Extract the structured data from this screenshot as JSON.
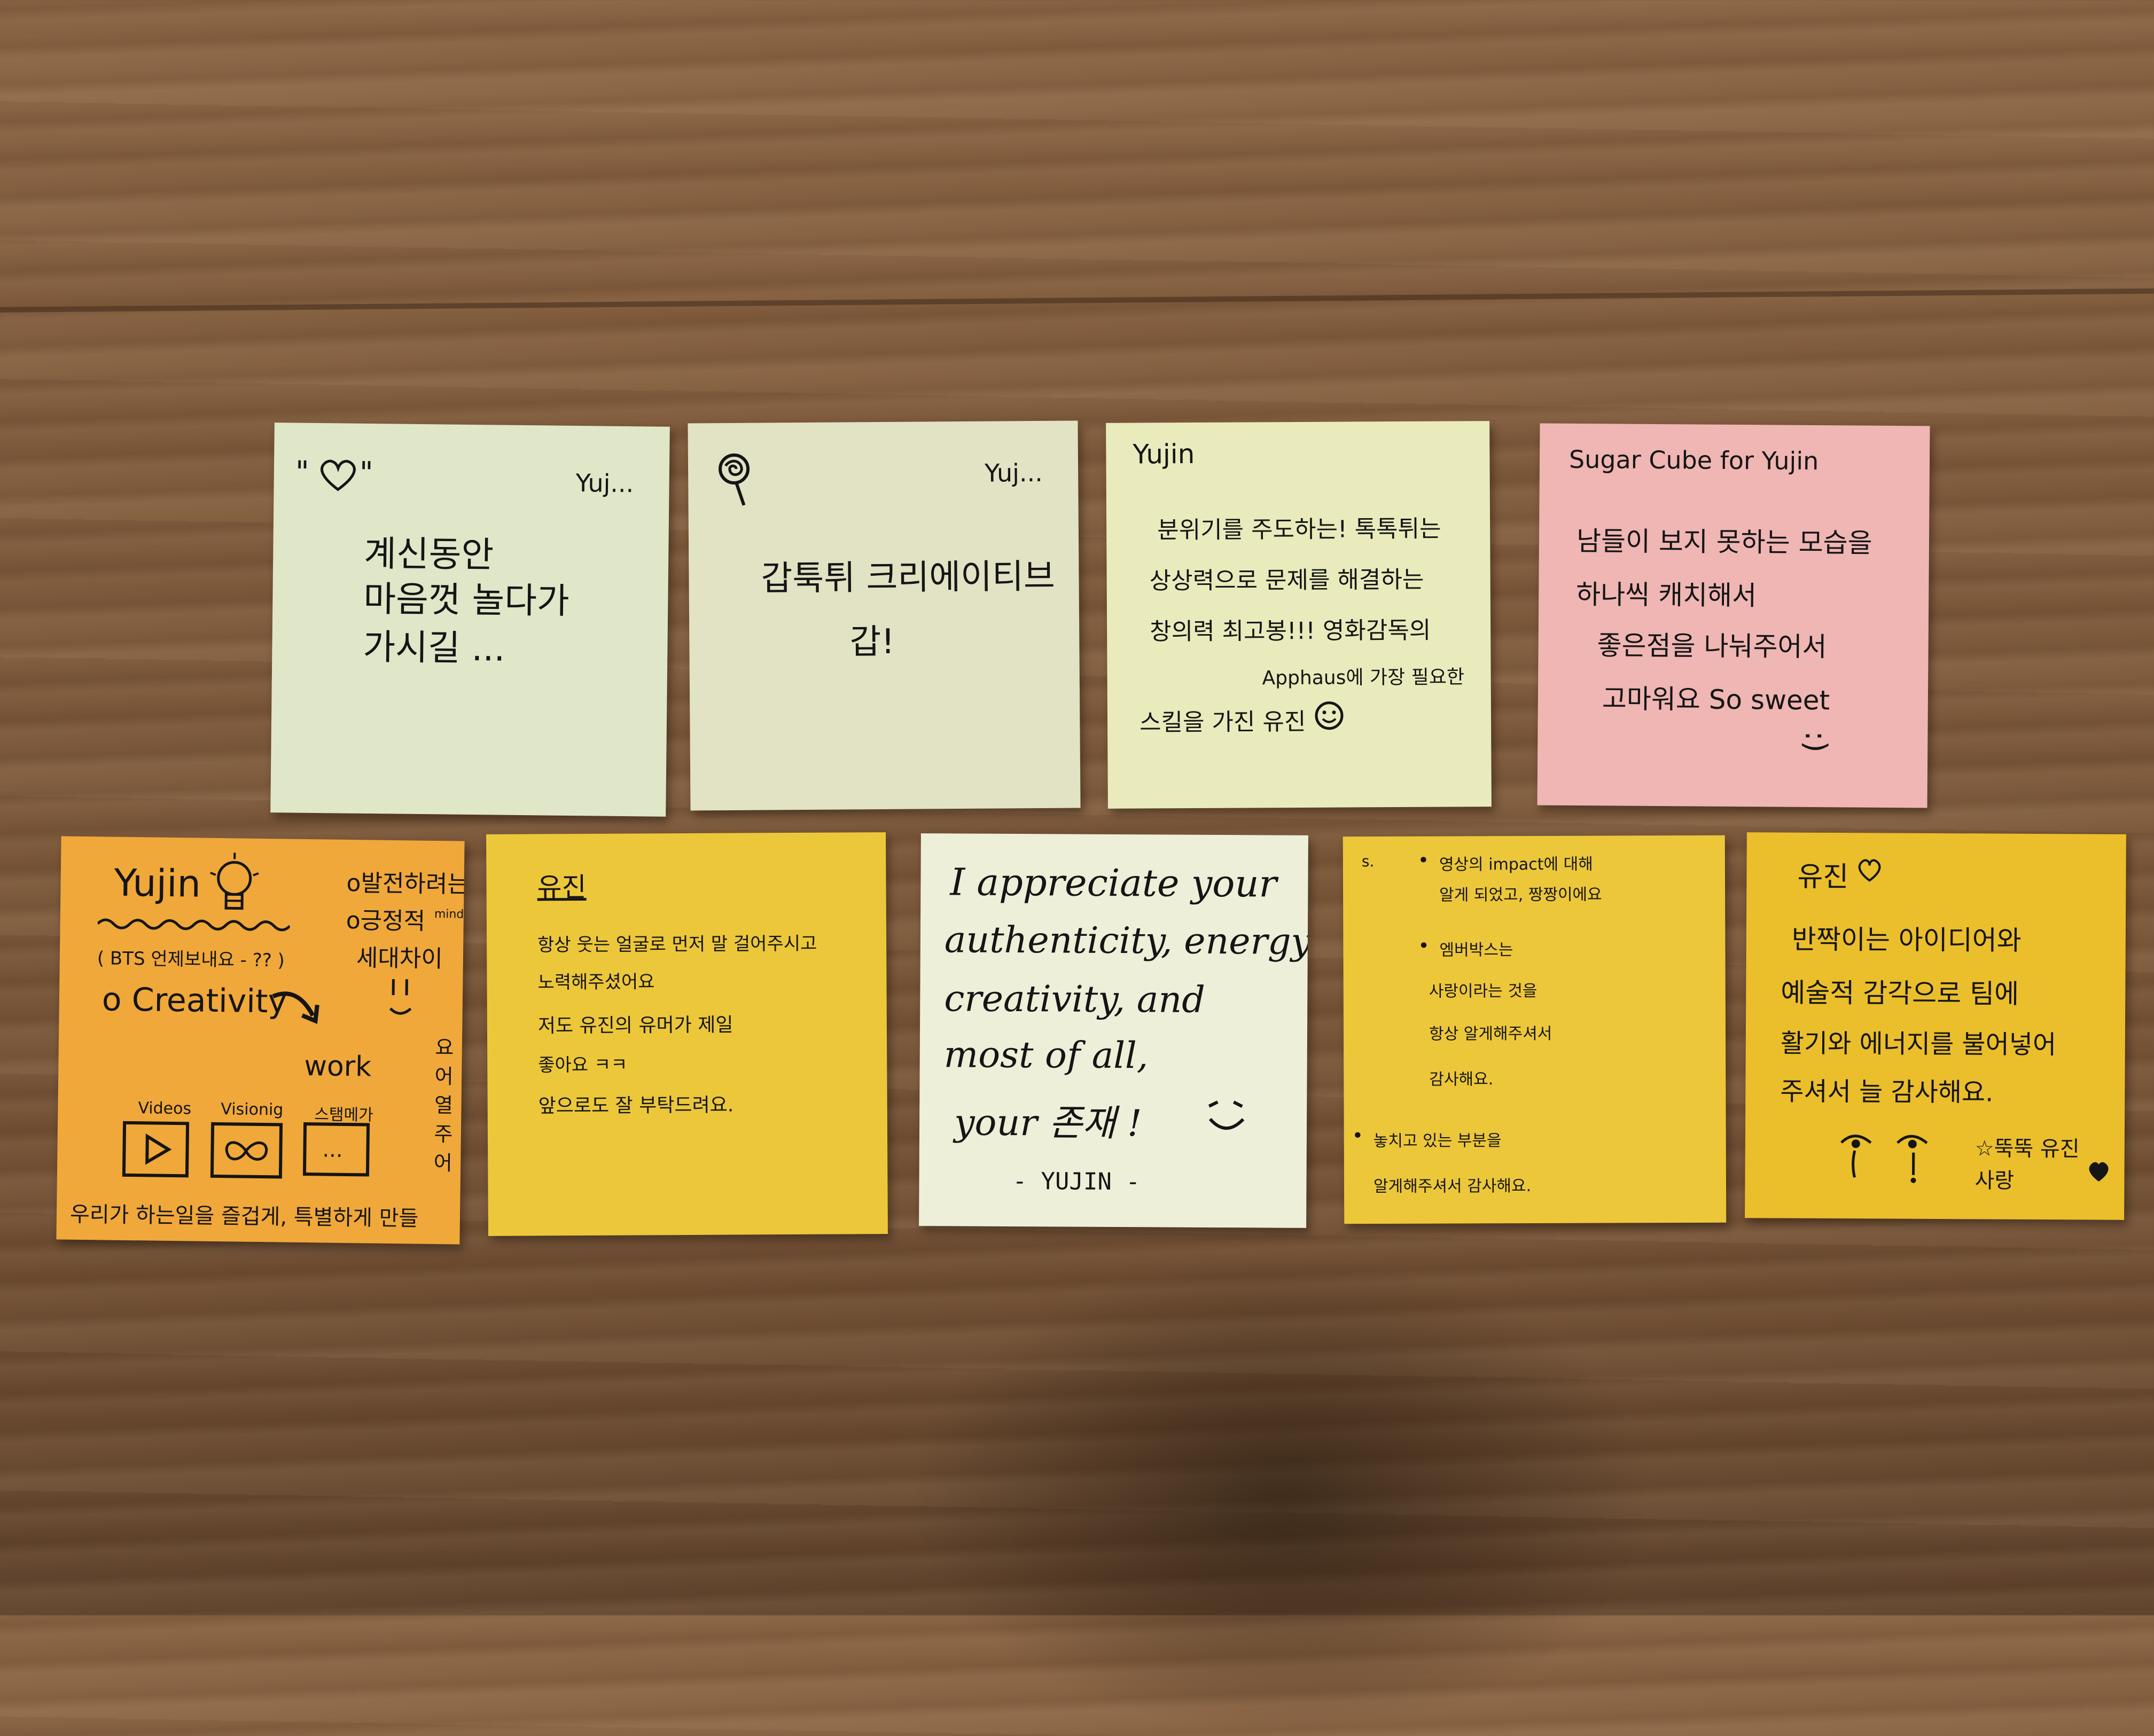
{
  "notes": [
    {
      "id": "note-1",
      "color": "#dfe7c8",
      "header_left": "\"",
      "header_left_end": "\"",
      "header_right": "Yuj...",
      "lines": [
        "계신동안",
        "마음껏  놀다가",
        "가시길 ..."
      ]
    },
    {
      "id": "note-2",
      "color": "#e2e2c4",
      "header_right": "Yuj...",
      "lines": [
        "갑툭튀 크리에이티브",
        "갑!"
      ]
    },
    {
      "id": "note-3",
      "color": "#e9ebbc",
      "header_left": "Yujin",
      "lines": [
        "분위기를 주도하는! 톡톡튀는",
        "상상력으로 문제를 해결하는",
        "창의력 최고봉!!!  영화감독의",
        "Apphaus에 가장 필요한",
        "스킬을 가진  유진"
      ]
    },
    {
      "id": "note-4",
      "color": "#efb6b4",
      "header_left": "Sugar Cube  for  Yujin",
      "lines": [
        "남들이 보지 못하는 모습을",
        "하나씩 캐치해서",
        "좋은점을 나눠주어서",
        "고마워요    So sweet"
      ],
      "smile": ":)"
    },
    {
      "id": "note-5",
      "color": "#f0a83a",
      "header_left": "Yujin",
      "top_right_lines": [
        "o발전하려는",
        "o긍정적",
        "세대차이"
      ],
      "top_right_small": "mind",
      "subtitle": "( BTS 언제보내요 - ?? )",
      "creativity": "o Creativity",
      "work": "work",
      "labels": [
        "Videos",
        "Visionig",
        "스탬메가"
      ],
      "box3_text": "...",
      "vertical_text": "요어열주어",
      "bottom_line": "우리가 하는일을 즐겁게, 특별하게 만들"
    },
    {
      "id": "note-6",
      "color": "#ecc73a",
      "header_left": "유진",
      "lines": [
        "항상 웃는 얼굴로 먼저 말 걸어주시고",
        "노력해주셨어요",
        "저도 유진의 유머가 제일",
        "좋아요 ㅋㅋ",
        "앞으로도 잘 부탁드려요."
      ]
    },
    {
      "id": "note-7",
      "color": "#eeefd8",
      "lines": [
        "I appreciate your",
        "authenticity, energy,",
        "creativity, and",
        "most of all,",
        "your 존재 !"
      ],
      "signature": "- YUJIN -"
    },
    {
      "id": "note-8",
      "color": "#ecc73a",
      "corner": "s.",
      "bullets": [
        [
          "영상의 impact에 대해",
          "알게 되었고, 짱짱이에요"
        ],
        [
          "엠버박스는",
          "사랑이라는 것을",
          "항상 알게해주셔서",
          "감사해요."
        ],
        [
          "놓치고 있는 부분을",
          "알게해주셔서 감사해요."
        ]
      ]
    },
    {
      "id": "note-9",
      "color": "#ebbe2c",
      "header_left": "유진",
      "lines": [
        "반짝이는 아이디어와",
        "예술적 감각으로 팀에",
        "활기와 에너지를 불어넣어",
        "주셔서 늘 감사해요."
      ],
      "signoff": "☆뚝뚝 유진사랑"
    }
  ]
}
